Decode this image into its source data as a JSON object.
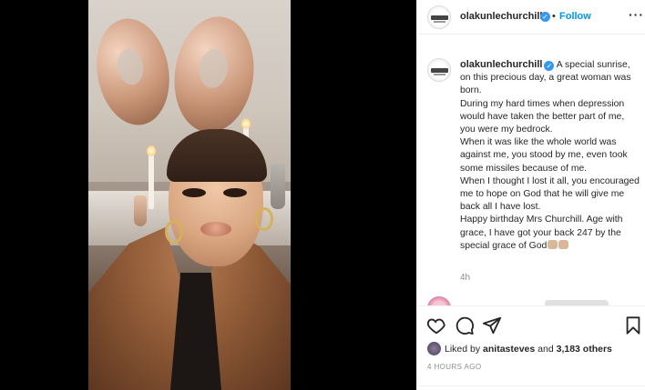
{
  "post": {
    "username": "olakunlechurchill",
    "follow_label": "Follow",
    "separator": "•",
    "verified_mark": "✓",
    "more_icon": "more-horizontal-icon"
  },
  "caption": {
    "username": "olakunlechurchill",
    "lines": [
      "A special sunrise, on this precious day, a great woman was born.",
      "During my hard times when depression would have taken the better part of me, you were my bedrock.",
      "When it was like the whole world was against me, you stood by me, even took some missiles because of me.",
      "When I thought I lost it all, you encouraged me to hope on God that he will give me back all I have lost.",
      "Happy birthday Mrs Churchill. Age with grace, I have got your back 247 by the special grace of God"
    ],
    "time": "4h"
  },
  "actions": {
    "icons": [
      "heart-icon",
      "comment-icon",
      "share-icon",
      "bookmark-icon"
    ],
    "likes_prefix": "Liked by",
    "liked_by_user": "anitasteves",
    "likes_conjunction": "and",
    "likes_count": "3,183 others",
    "posted_ago": "4 HOURS AGO"
  },
  "colors": {
    "accent": "#0095f6",
    "verified": "#3897f0",
    "muted": "#8e8e8e",
    "text": "#262626"
  }
}
